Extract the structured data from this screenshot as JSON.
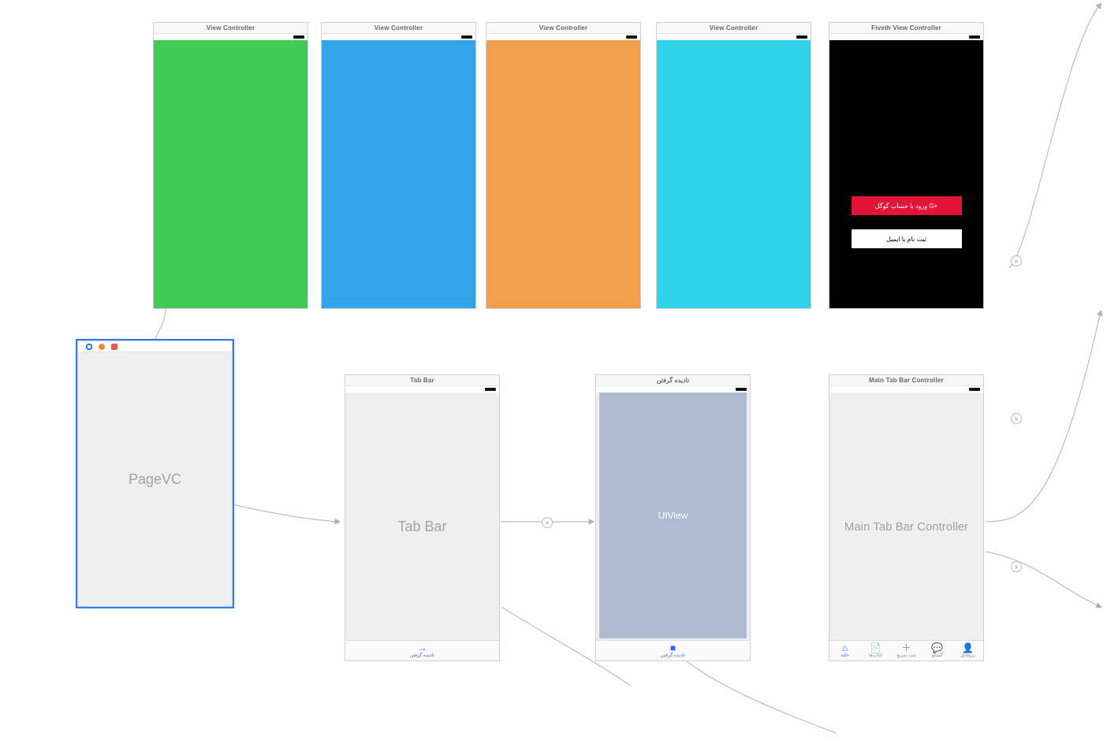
{
  "top": [
    {
      "title": "View Controller",
      "bg": "green"
    },
    {
      "title": "View Controller",
      "bg": "blue"
    },
    {
      "title": "View Controller",
      "bg": "orange"
    },
    {
      "title": "View Controller",
      "bg": "cyan"
    },
    {
      "title": "Fiveth View Controller",
      "bg": "black"
    }
  ],
  "login": {
    "google": "ورود با حساب گوگل  G+",
    "email": "ثبت نام با ایمیل"
  },
  "pagevc": {
    "label": "PageVC"
  },
  "tabbar_scene": {
    "title": "Tab Bar",
    "center": "Tab Bar",
    "tab_label": "نادیده گرفتن"
  },
  "ignore_scene": {
    "title": "نادیده گرفتن",
    "uiview": "UIView",
    "tab_label": "نادیده گرفتن"
  },
  "main_tab": {
    "title": "Main Tab Bar Controller",
    "center": "Main Tab Bar Controller",
    "tabs": [
      {
        "label": "خانه"
      },
      {
        "label": "کتاب‌ها"
      },
      {
        "label": "ثبت سریع"
      },
      {
        "label": "گفتگو"
      },
      {
        "label": "پروفایل"
      }
    ]
  }
}
